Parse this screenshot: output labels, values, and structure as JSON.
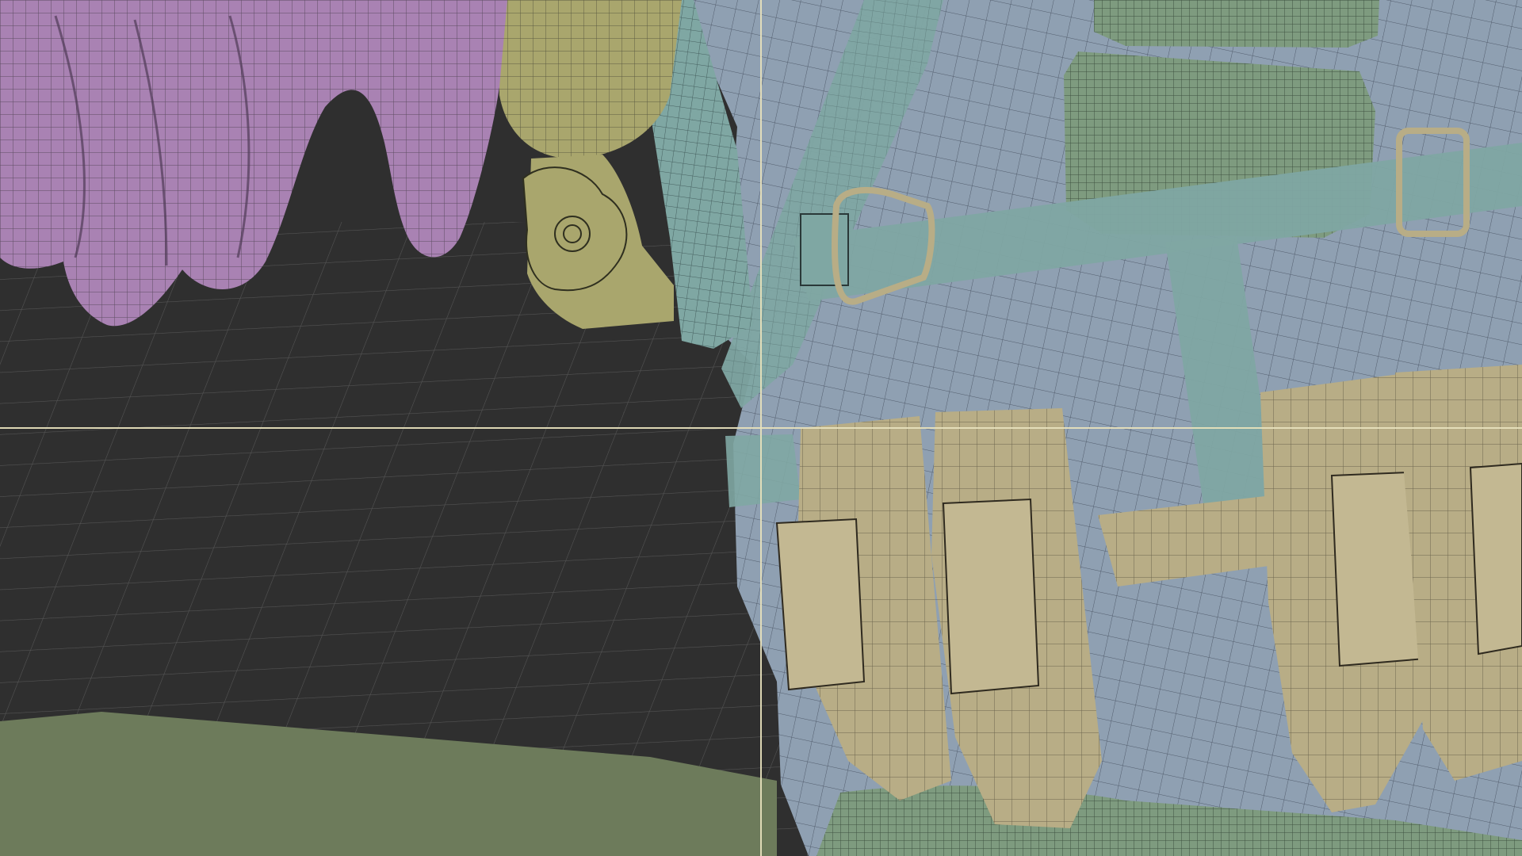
{
  "viewport": {
    "mode": "wireframe-overlay",
    "colors": {
      "background": "#2f2f2f",
      "grid": "#595959",
      "ground": "#6d7b5b",
      "glove": "#a982b3",
      "body": "#8fa0b2",
      "gear_green": "#7e9b7f",
      "tan": "#b8ad86",
      "teal": "#7fa7a3",
      "olive": "#a9a66d",
      "crosshair": "#e7e1bc"
    }
  }
}
